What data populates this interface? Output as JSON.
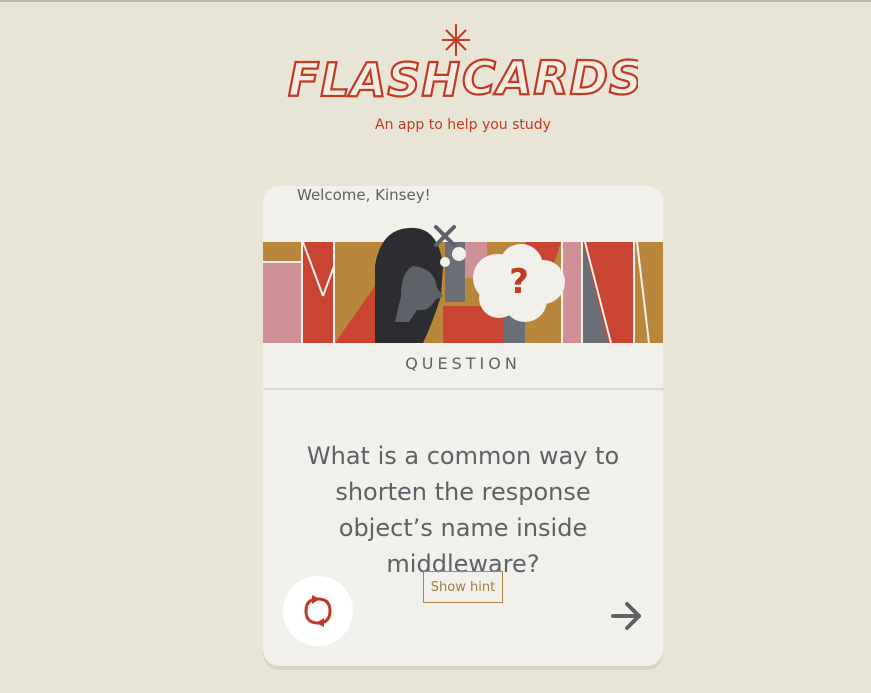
{
  "app": {
    "title": "FLASH CARDS",
    "tagline": "An app to help you study"
  },
  "card": {
    "welcome": "Welcome, Kinsey!",
    "kind": "QUESTION",
    "question": "What is a common way to shorten the response object’s name inside middleware?",
    "hint_label": "Show hint"
  },
  "colors": {
    "background": "#e9e5d6",
    "brand_red": "#c03a26",
    "text_gray": "#5f6168",
    "mustard": "#b9873b",
    "pink": "#cf9197",
    "slate": "#6a6f77"
  },
  "icons": {
    "close": "close-icon",
    "flip": "flip-icon",
    "next": "arrow-right-icon"
  }
}
